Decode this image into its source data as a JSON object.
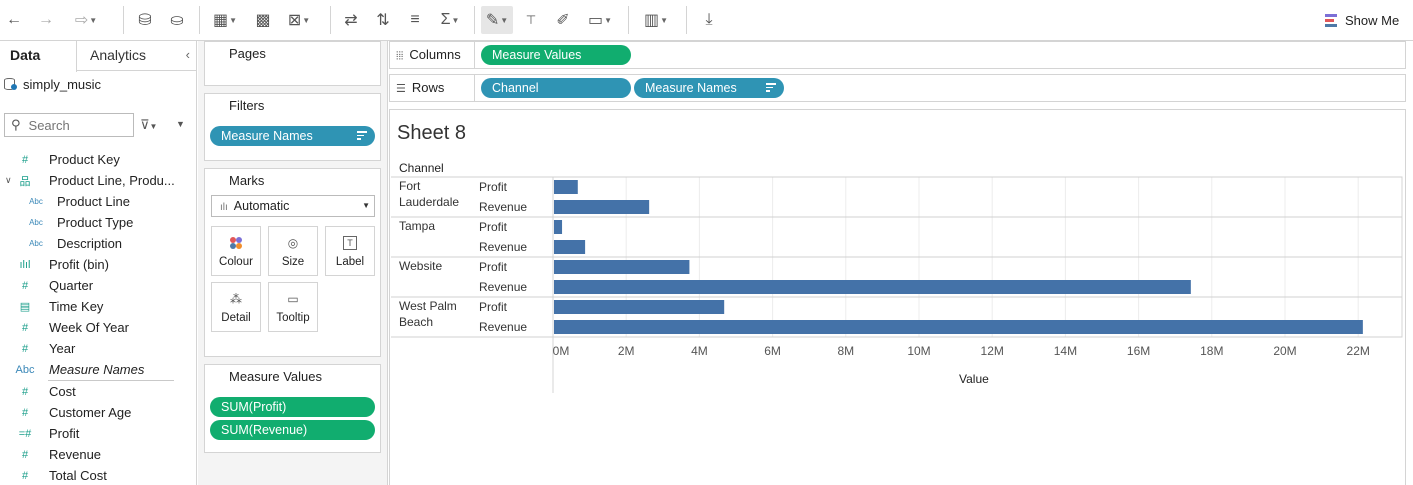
{
  "toolbar": {
    "show_me_label": "Show Me"
  },
  "data_pane": {
    "tabs": [
      "Data",
      "Analytics"
    ],
    "datasource": "simply_music",
    "search_placeholder": "Search",
    "fields": [
      {
        "label": "Product Key",
        "icon": "#",
        "level": 0
      },
      {
        "label": "Product Line, Produ...",
        "icon": "hierarchy",
        "level": 0,
        "expanded": true
      },
      {
        "label": "Product Line",
        "icon": "Abc",
        "level": 1
      },
      {
        "label": "Product Type",
        "icon": "Abc",
        "level": 1
      },
      {
        "label": "Description",
        "icon": "Abc",
        "level": 1
      },
      {
        "label": "Profit (bin)",
        "icon": "bin",
        "level": 0
      },
      {
        "label": "Quarter",
        "icon": "#",
        "level": 0
      },
      {
        "label": "Time Key",
        "icon": "calendar",
        "level": 0
      },
      {
        "label": "Week Of Year",
        "icon": "#",
        "level": 0
      },
      {
        "label": "Year",
        "icon": "#",
        "level": 0
      },
      {
        "label": "Measure Names",
        "icon": "Abc",
        "level": 0,
        "italic": true
      }
    ],
    "measures": [
      {
        "label": "Cost",
        "icon": "#"
      },
      {
        "label": "Customer Age",
        "icon": "#"
      },
      {
        "label": "Profit",
        "icon": "=#"
      },
      {
        "label": "Revenue",
        "icon": "#"
      },
      {
        "label": "Total Cost",
        "icon": "#"
      }
    ]
  },
  "cards": {
    "pages": "Pages",
    "filters": "Filters",
    "filter_pill": "Measure Names",
    "marks": "Marks",
    "marks_type": "Automatic",
    "mark_buttons": [
      "Colour",
      "Size",
      "Label",
      "Detail",
      "Tooltip"
    ],
    "measure_values": "Measure Values",
    "measure_value_pills": [
      "SUM(Profit)",
      "SUM(Revenue)"
    ]
  },
  "shelves": {
    "columns_label": "Columns",
    "columns_pills": [
      "Measure Values"
    ],
    "rows_label": "Rows",
    "rows_pills": [
      "Channel",
      "Measure Names"
    ]
  },
  "sheet": {
    "title": "Sheet 8",
    "row_header": "Channel"
  },
  "chart_data": {
    "type": "bar",
    "orientation": "horizontal",
    "channels": [
      {
        "name": "Fort Lauderdale",
        "lines": [
          "Fort",
          "Lauderdale"
        ],
        "profit": 0.65,
        "revenue": 2.6
      },
      {
        "name": "Tampa",
        "lines": [
          "Tampa"
        ],
        "profit": 0.22,
        "revenue": 0.85
      },
      {
        "name": "Website",
        "lines": [
          "Website"
        ],
        "profit": 3.7,
        "revenue": 17.4
      },
      {
        "name": "West Palm Beach",
        "lines": [
          "West Palm",
          "Beach"
        ],
        "profit": 4.65,
        "revenue": 22.1
      }
    ],
    "measure_labels": [
      "Profit",
      "Revenue"
    ],
    "xlim": [
      0,
      23
    ],
    "ticks": [
      0,
      2,
      4,
      6,
      8,
      10,
      12,
      14,
      16,
      18,
      20,
      22
    ],
    "tick_labels": [
      "0M",
      "2M",
      "4M",
      "6M",
      "8M",
      "10M",
      "12M",
      "14M",
      "16M",
      "18M",
      "20M",
      "22M"
    ],
    "xlabel": "Value",
    "bar_color": "#4472a8",
    "grid": true
  }
}
